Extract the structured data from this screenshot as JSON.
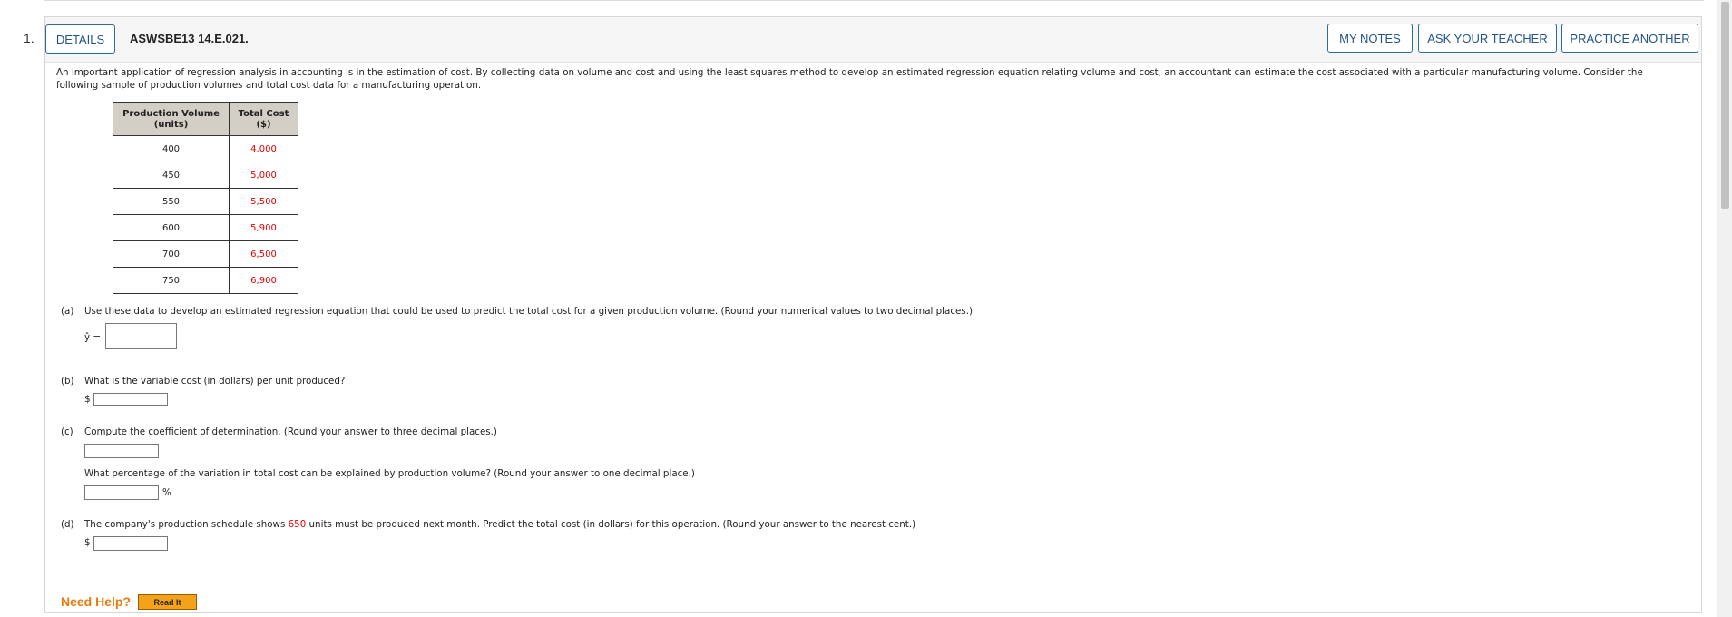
{
  "question": {
    "number": "1.",
    "code": "ASWSBE13 14.E.021."
  },
  "header": {
    "details_label": "DETAILS",
    "my_notes_label": "MY NOTES",
    "ask_teacher_label": "ASK YOUR TEACHER",
    "practice_another_label": "PRACTICE ANOTHER"
  },
  "intro_text": "An important application of regression analysis in accounting is in the estimation of cost. By collecting data on volume and cost and using the least squares method to develop an estimated regression equation relating volume and cost, an accountant can estimate the cost associated with a particular manufacturing volume. Consider the following sample of production volumes and total cost data for a manufacturing operation.",
  "table": {
    "headers": [
      "Production Volume (units)",
      "Total Cost ($)"
    ],
    "rows": [
      [
        "400",
        "4,000"
      ],
      [
        "450",
        "5,000"
      ],
      [
        "550",
        "5,500"
      ],
      [
        "600",
        "5,900"
      ],
      [
        "700",
        "6,500"
      ],
      [
        "750",
        "6,900"
      ]
    ]
  },
  "parts": {
    "a_label": "(a)",
    "a_text": "Use these data to develop an estimated regression equation that could be used to predict the total cost for a given production volume. (Round your numerical values to two decimal places.)",
    "a_prefix": "ŷ =",
    "b_label": "(b)",
    "b_text": "What is the variable cost (in dollars) per unit produced?",
    "b_prefix": "$",
    "c_label": "(c)",
    "c_text": "Compute the coefficient of determination. (Round your answer to three decimal places.)",
    "c_text2": "What percentage of the variation in total cost can be explained by production volume? (Round your answer to one decimal place.)",
    "c_suffix": "%",
    "d_label": "(d)",
    "d_text_before": "The company's production schedule shows",
    "d_value": "650",
    "d_text_after": "units must be produced next month. Predict the total cost (in dollars) for this operation. (Round your answer to the nearest cent.)",
    "d_prefix": "$"
  },
  "help": {
    "need_help": "Need Help?",
    "read_it": "Read It"
  },
  "colors": {
    "accent": "#22548a",
    "highlight_red": "#e00000",
    "help_orange": "#e8790b"
  }
}
